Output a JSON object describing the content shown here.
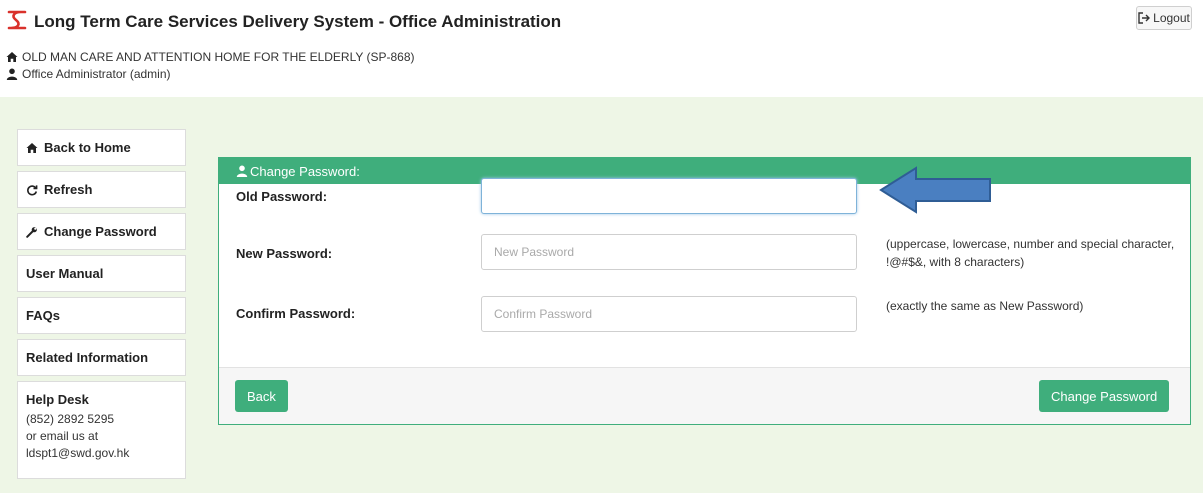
{
  "header": {
    "app_title": "Long Term Care Services Delivery System - Office Administration",
    "organization": "OLD MAN CARE AND ATTENTION HOME FOR THE ELDERLY (SP-868)",
    "user": "Office Administrator (admin)",
    "logout_label": "Logout",
    "logo_icon": "swd-logo-icon",
    "brand_color": "#d9312b"
  },
  "sidebar": {
    "items": [
      {
        "label": "Back to Home",
        "icon": "home-icon"
      },
      {
        "label": "Refresh",
        "icon": "refresh-icon"
      },
      {
        "label": "Change Password",
        "icon": "wrench-icon"
      },
      {
        "label": "User Manual"
      },
      {
        "label": "FAQs"
      },
      {
        "label": "Related Information"
      }
    ],
    "helpdesk": {
      "title": "Help Desk",
      "phone": "(852) 2892 5295",
      "email_prefix": "or email us at",
      "email": "ldspt1@swd.gov.hk"
    }
  },
  "panel": {
    "title": "Change Password:",
    "title_icon": "user-icon",
    "accent_color": "#3fae7c",
    "fields": {
      "old": {
        "label": "Old Password:",
        "value": "",
        "placeholder": ""
      },
      "new": {
        "label": "New Password:",
        "value": "",
        "placeholder": "New Password",
        "hint": "(uppercase, lowercase, number and special character, !@#$&, with 8 characters)"
      },
      "confirm": {
        "label": "Confirm Password:",
        "value": "",
        "placeholder": "Confirm Password",
        "hint": "(exactly the same as New Password)"
      }
    },
    "back_label": "Back",
    "submit_label": "Change Password"
  },
  "annotation": {
    "icon": "pointer-arrow-icon",
    "color": "#4a7fc1"
  }
}
